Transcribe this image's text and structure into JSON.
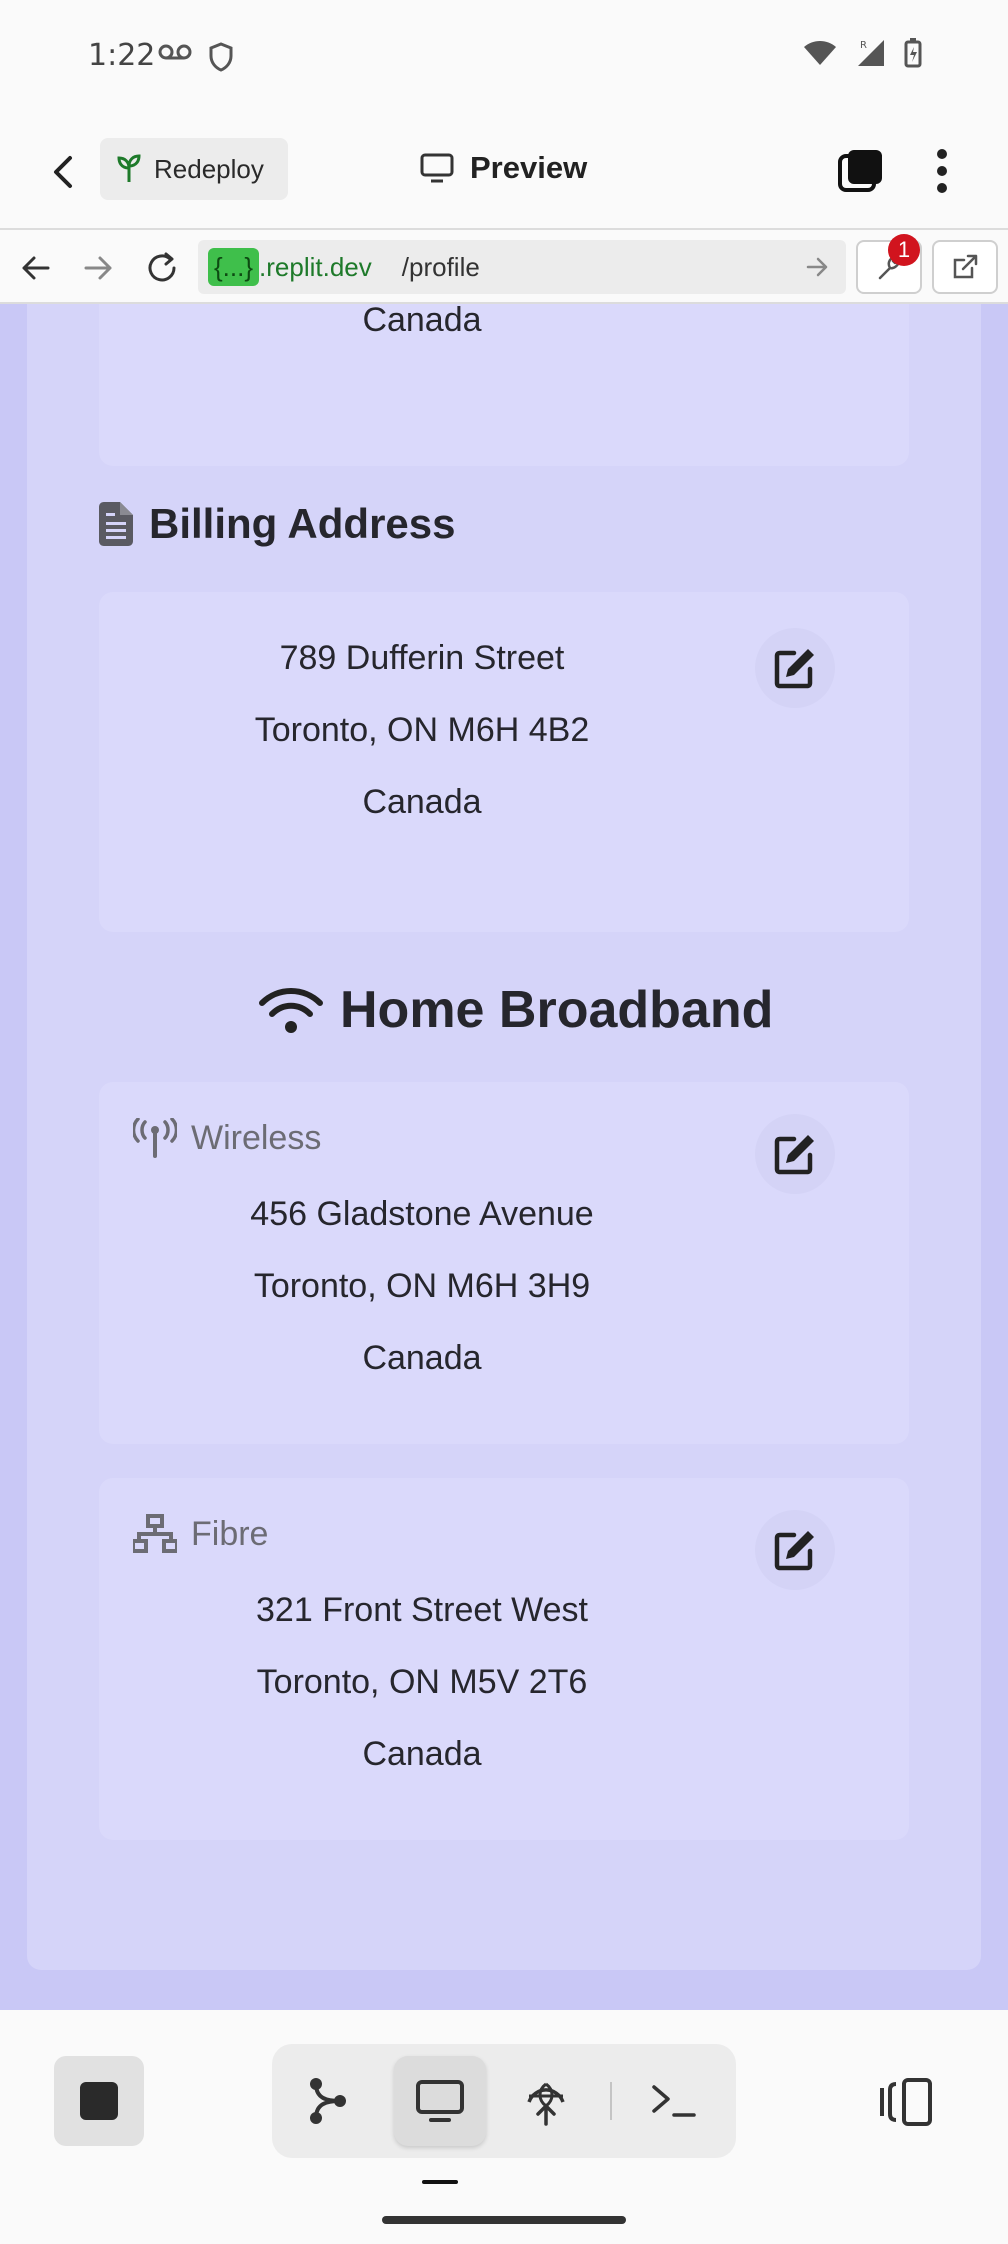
{
  "status_bar": {
    "time": "1:22"
  },
  "header": {
    "redeploy_label": "Redeploy",
    "title": "Preview"
  },
  "url_bar": {
    "host_badge": "{...}",
    "host": ".replit.dev",
    "path": "/profile",
    "notification_count": "1"
  },
  "page": {
    "top_card": {
      "line": "Canada"
    },
    "billing": {
      "heading": "Billing Address",
      "lines": [
        "789 Dufferin Street",
        "Toronto, ON M6H 4B2",
        "Canada"
      ]
    },
    "broadband": {
      "heading": "Home Broadband",
      "wireless": {
        "label": "Wireless",
        "lines": [
          "456 Gladstone Avenue",
          "Toronto, ON M6H 3H9",
          "Canada"
        ]
      },
      "fibre": {
        "label": "Fibre",
        "lines": [
          "321 Front Street West",
          "Toronto, ON M5V 2T6",
          "Canada"
        ]
      }
    }
  },
  "icons": {
    "header": [
      "back-arrow-icon",
      "sprout-icon",
      "monitor-icon",
      "tabs-icon",
      "more-vertical-icon"
    ],
    "url_bar": [
      "back-icon",
      "forward-icon",
      "reload-icon",
      "wrench-icon",
      "external-link-icon"
    ],
    "sections": [
      "file-text-icon",
      "wifi-icon",
      "antenna-icon",
      "network-icon",
      "edit-icon"
    ],
    "bottom": [
      "stop-icon",
      "branch-icon",
      "monitor-icon",
      "globe-deploy-icon",
      "terminal-icon",
      "split-panel-icon"
    ]
  },
  "colors": {
    "page_background": "#c9c8f6",
    "card_background": "#d5d4f9",
    "address_card": "#dad9fb",
    "url_host": "#1e7a2a",
    "host_badge": "#3fbf4b",
    "notification": "#d1141e"
  }
}
